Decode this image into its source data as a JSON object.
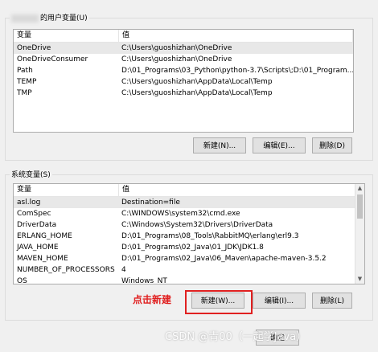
{
  "user_vars": {
    "group_label": "的用户变量(U)",
    "col_var": "变量",
    "col_val": "值",
    "rows": [
      {
        "name": "OneDrive",
        "value": "C:\\Users\\guoshizhan\\OneDrive"
      },
      {
        "name": "OneDriveConsumer",
        "value": "C:\\Users\\guoshizhan\\OneDrive"
      },
      {
        "name": "Path",
        "value": "D:\\01_Programs\\03_Python\\python-3.7\\Scripts\\;D:\\01_Program..."
      },
      {
        "name": "TEMP",
        "value": "C:\\Users\\guoshizhan\\AppData\\Local\\Temp"
      },
      {
        "name": "TMP",
        "value": "C:\\Users\\guoshizhan\\AppData\\Local\\Temp"
      }
    ],
    "new_btn": "新建(N)...",
    "edit_btn": "编辑(E)...",
    "delete_btn": "删除(D)"
  },
  "sys_vars": {
    "group_label": "系统变量(S)",
    "col_var": "变量",
    "col_val": "值",
    "rows": [
      {
        "name": "asl.log",
        "value": "Destination=file"
      },
      {
        "name": "ComSpec",
        "value": "C:\\WINDOWS\\system32\\cmd.exe"
      },
      {
        "name": "DriverData",
        "value": "C:\\Windows\\System32\\Drivers\\DriverData"
      },
      {
        "name": "ERLANG_HOME",
        "value": "D:\\01_Programs\\08_Tools\\RabbitMQ\\erlang\\erl9.3"
      },
      {
        "name": "JAVA_HOME",
        "value": "D:\\01_Programs\\02_Java\\01_JDK\\JDK1.8"
      },
      {
        "name": "MAVEN_HOME",
        "value": "D:\\01_Programs\\02_Java\\06_Maven\\apache-maven-3.5.2"
      },
      {
        "name": "NUMBER_OF_PROCESSORS",
        "value": "4"
      },
      {
        "name": "OS",
        "value": "Windows_NT"
      }
    ],
    "new_btn": "新建(W)...",
    "edit_btn": "编辑(I)...",
    "delete_btn": "删除(L)"
  },
  "annotation": "点击新建",
  "ok_btn": "确定",
  "watermark": "CSDN @青00（一起学Java）",
  "accent_color": "#e02020"
}
